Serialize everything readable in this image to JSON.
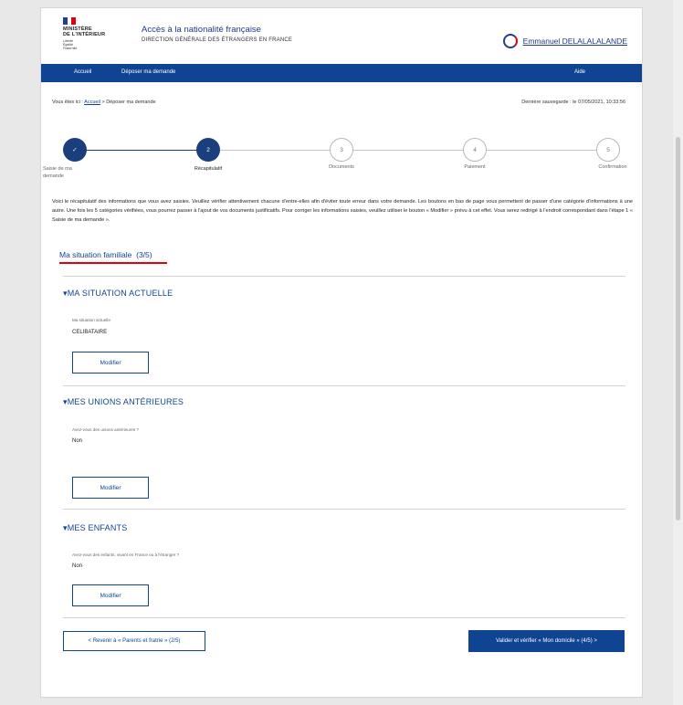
{
  "header": {
    "logo_flag_colors": [
      "#213f8f",
      "#ffffff",
      "#e1000f"
    ],
    "logo_lines": [
      "MINISTÈRE",
      "DE L'INTÉRIEUR"
    ],
    "logo_motto": [
      "Liberté",
      "Égalité",
      "Fraternité"
    ],
    "site_title": "Accès à la nationalité française",
    "site_subtitle": "DIRECTION GÉNÉRALE DES ÉTRANGERS EN FRANCE",
    "user_name": "Emmanuel DELALALALANDE"
  },
  "nav": {
    "home": "Accueil",
    "submit": "Déposer ma demande",
    "help": "Aide"
  },
  "breadcrumb": {
    "prefix": "Vous êtes ici :",
    "home": "Accueil",
    "separator": ">",
    "current": "Déposer ma demande"
  },
  "last_saved": "Dernière sauvegarde : le 07/05/2021, 10:33:56",
  "steps": [
    {
      "number": "✓",
      "label": "Saisie de ma demande",
      "state": "done"
    },
    {
      "number": "2",
      "label": "Récapitulatif",
      "state": "current"
    },
    {
      "number": "3",
      "label": "Documents",
      "state": "todo"
    },
    {
      "number": "4",
      "label": "Paiement",
      "state": "todo"
    },
    {
      "number": "5",
      "label": "Confirmation",
      "state": "todo"
    }
  ],
  "intro": "Voici le récapitulatif des informations que vous avez saisies. Veuillez vérifier attentivement chacune d'entre-elles afin d'éviter toute erreur dans votre demande. Les boutons en bas de page vous permettent de passer d'une catégorie d'informations à une autre. Une fois les 5 catégories vérifiées, vous pourrez passer à l'ajout de vos documents justificatifs. Pour corriger les informations saisies, veuillez utiliser le bouton « Modifier » prévu à cet effet. Vous serez redirigé à l'endroit correspondant dans l'étape 1 « Saisie de ma demande ».",
  "section": {
    "title": "Ma situation familiale",
    "progress": "(3/5)"
  },
  "blocks": [
    {
      "heading": "MA SITUATION ACTUELLE",
      "question": "Ma situation actuelle",
      "answer": "CELIBATAIRE",
      "button": "Modifier"
    },
    {
      "heading": "MES UNIONS ANTÉRIEURES",
      "question": "Avez-vous des unions antérieures ?",
      "answer": "Non",
      "button": "Modifier"
    },
    {
      "heading": "MES ENFANTS",
      "question": "Avez-vous des enfants, vivant en France ou à l'étranger ?",
      "answer": "Non",
      "button": "Modifier"
    }
  ],
  "footer_nav": {
    "prev": "< Revenir à « Parents et fratrie » (2/5)",
    "next": "Valider et vérifier « Mon domicile » (4/5) >"
  },
  "back_to_top_icon": "chevron-up-icon",
  "colors": {
    "primary": "#0f4493",
    "accent_red": "#e1000f",
    "step_done": "#1b3f7c"
  }
}
